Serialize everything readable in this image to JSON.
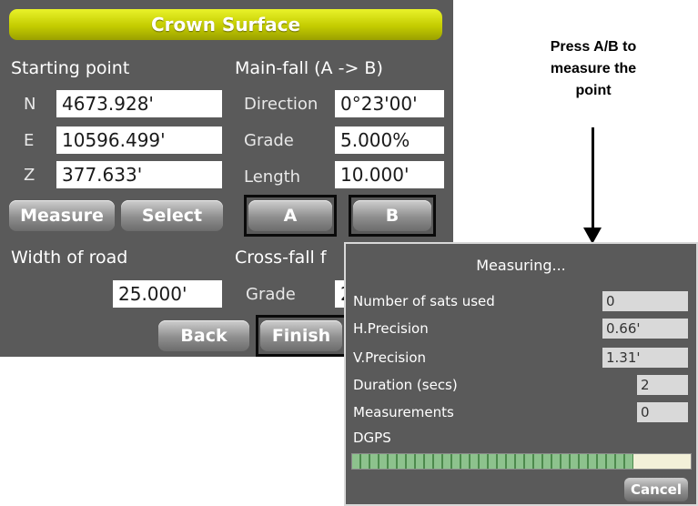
{
  "title": "Crown Surface",
  "starting_point": {
    "label": "Starting point",
    "n_label": "N",
    "n_value": "4673.928'",
    "e_label": "E",
    "e_value": "10596.499'",
    "z_label": "Z",
    "z_value": "377.633'"
  },
  "main_fall": {
    "label": "Main-fall (A -> B)",
    "direction_label": "Direction",
    "direction_value": "0°23'00'",
    "grade_label": "Grade",
    "grade_value": "5.000%",
    "length_label": "Length",
    "length_value": "10.000'"
  },
  "buttons": {
    "measure": "Measure",
    "select": "Select",
    "a": "A",
    "b": "B",
    "back": "Back",
    "finish": "Finish"
  },
  "width_of_road": {
    "label": "Width of road",
    "value": "25.000'"
  },
  "cross_fall": {
    "label": "Cross-fall f",
    "grade_label": "Grade",
    "grade_value": "2"
  },
  "callout": {
    "line1": "Press A/B to",
    "line2": "measure the",
    "line3": "point"
  },
  "dialog": {
    "title": "Measuring...",
    "rows": [
      {
        "label": "Number of sats used",
        "value": "0"
      },
      {
        "label": "H.Precision",
        "value": "0.66'"
      },
      {
        "label": "V.Precision",
        "value": "1.31'"
      },
      {
        "label": "Duration (secs)",
        "value": "2"
      },
      {
        "label": "Measurements",
        "value": "0"
      }
    ],
    "dgps_label": "DGPS",
    "dgps_progress": 0.83,
    "cancel": "Cancel"
  },
  "colors": {
    "title_bar": "#c4cc00",
    "panel": "#5a5a5a",
    "highlight_frame": "#0a0a0a"
  }
}
